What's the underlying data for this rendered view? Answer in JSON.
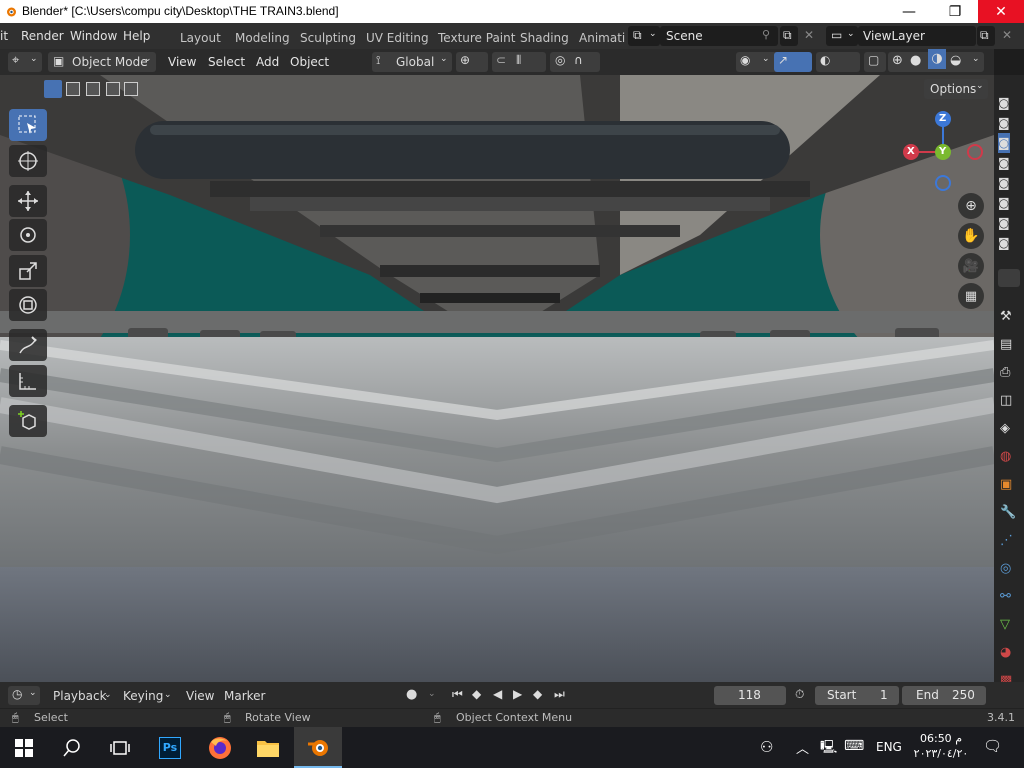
{
  "window": {
    "title": "Blender* [C:\\Users\\compu city\\Desktop\\THE TRAIN3.blend]",
    "minimize": "—",
    "maximize": "❐",
    "close": "✕"
  },
  "menu": [
    "it",
    "Render",
    "Window",
    "Help"
  ],
  "workspaces": [
    "Layout",
    "Modeling",
    "Sculpting",
    "UV Editing",
    "Texture Paint",
    "Shading",
    "Animati"
  ],
  "scene": {
    "label": "Scene"
  },
  "viewlayer": {
    "label": "ViewLayer"
  },
  "header": {
    "mode": "Object Mode",
    "menus": [
      "View",
      "Select",
      "Add",
      "Object"
    ],
    "transform_orientation": "Global",
    "options": "Options"
  },
  "gizmo": {
    "x": "X",
    "y": "Y",
    "z": "Z"
  },
  "timeline": {
    "menus": [
      "Playback",
      "Keying",
      "View",
      "Marker"
    ],
    "current_frame": "118",
    "start_label": "Start",
    "start_value": "1",
    "end_label": "End",
    "end_value": "250"
  },
  "status": {
    "select": "Select",
    "rotate": "Rotate View",
    "context": "Object Context Menu",
    "version": "3.4.1"
  },
  "taskbar": {
    "lang": "ENG",
    "time": "06:50 م",
    "date": "٢٠٢٣/٠٤/٢٠"
  },
  "colors": {
    "accent": "#4772b3",
    "close_red": "#e81123",
    "axis_x": "#d03a4a",
    "axis_y": "#7ab92f",
    "axis_z": "#3c78d8"
  }
}
